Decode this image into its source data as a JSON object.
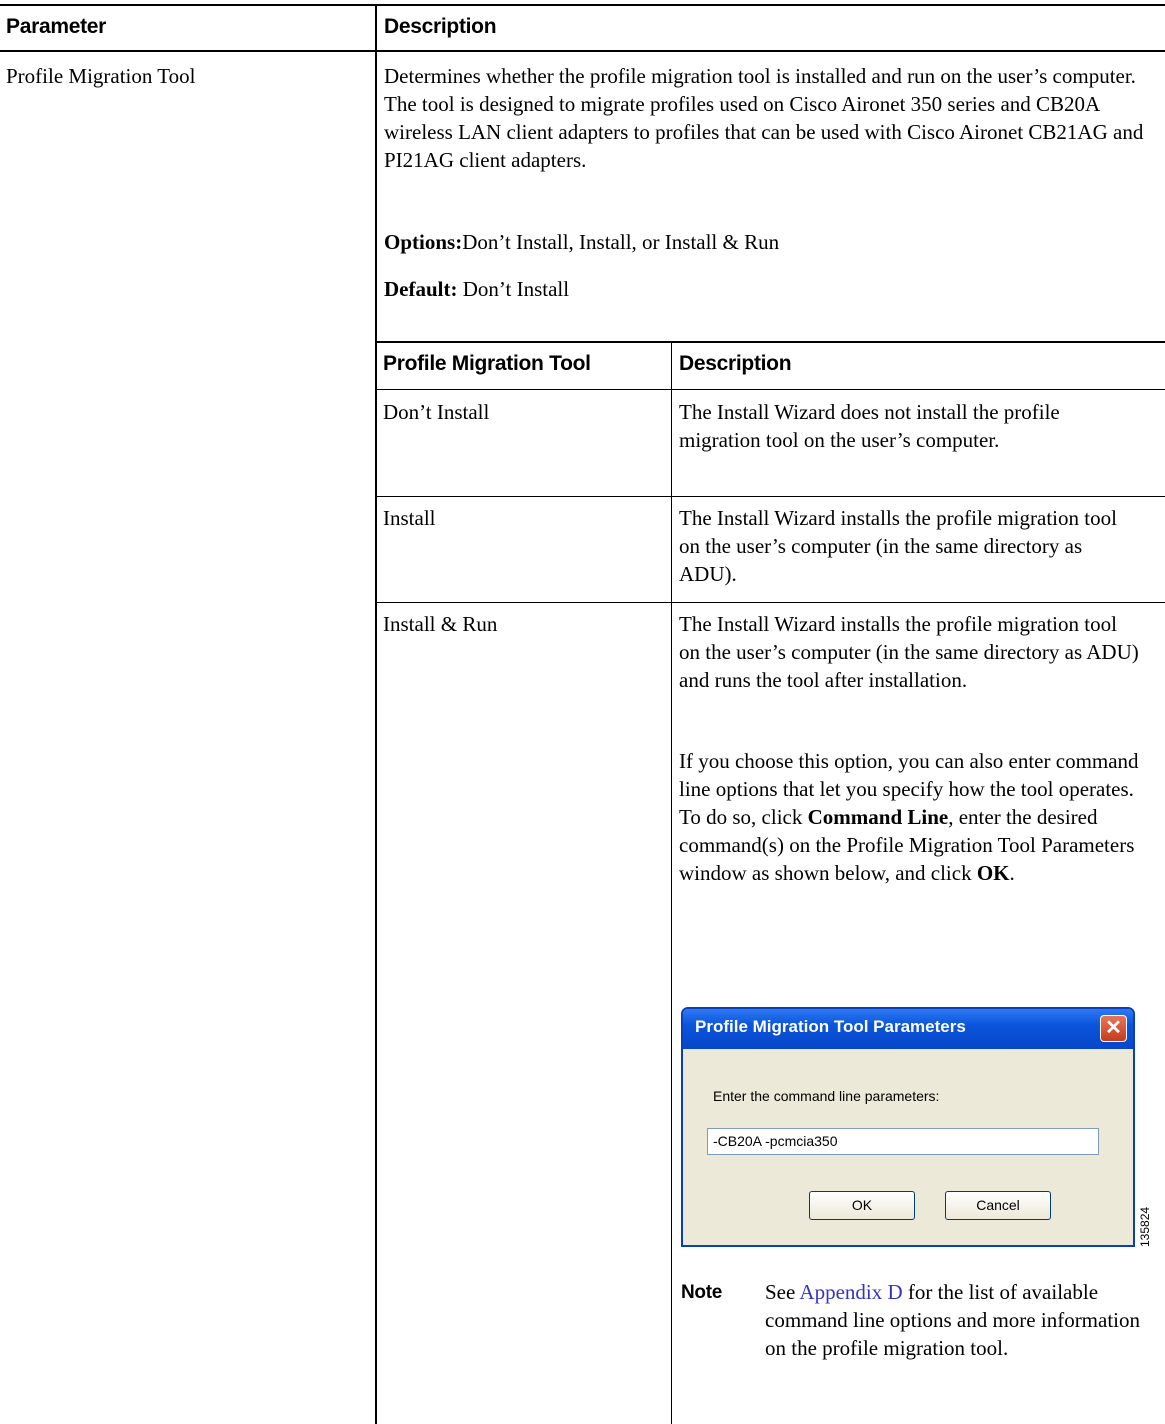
{
  "table": {
    "header": {
      "col1": "Parameter",
      "col2": "Description"
    },
    "row": {
      "parameter": "Profile Migration Tool",
      "description": "Determines whether the profile migration tool is installed and run on the user’s computer. The tool is designed to migrate profiles used on Cisco Aironet 350 series and CB20A wireless LAN client adapters to profiles that can be used with Cisco Aironet CB21AG and PI21AG client adapters.",
      "options_label": "Options:",
      "options_value": "Don’t Install, Install, or Install & Run",
      "default_label": "Default:",
      "default_value": " Don’t Install"
    }
  },
  "subtable": {
    "header": {
      "col1": "Profile Migration Tool",
      "col2": "Description"
    },
    "rows": [
      {
        "option": "Don’t Install",
        "description": "The Install Wizard does not install the profile migration tool on the user’s computer."
      },
      {
        "option": "Install",
        "description": "The Install Wizard installs the profile migration tool on the user’s computer (in the same directory as ADU)."
      },
      {
        "option": "Install & Run",
        "description": "The Install Wizard installs the profile migration tool on the user’s computer (in the same directory as ADU) and runs the tool after installation."
      }
    ],
    "install_run_more": {
      "p1": "If you choose this option, you can also enter command line options that let you specify how the tool operates. To do so, click ",
      "cmd": "Command Line",
      "p2": ", enter the desired command(s) on the Profile Migration Tool Parameters window as shown below, and click ",
      "ok": "OK",
      "p3": "."
    }
  },
  "dialog": {
    "title": "Profile Migration Tool Parameters",
    "label": "Enter the command line parameters:",
    "input_value": "-CB20A -pcmcia350",
    "ok_button": "OK",
    "cancel_button": "Cancel",
    "figure_id": "135824"
  },
  "note": {
    "label": "Note",
    "text1": "See ",
    "link": "Appendix D",
    "text2": " for the list of available command line options and more information on the profile migration tool."
  },
  "colors": {
    "link": "#3333cc",
    "title_bar": "#0a55dc",
    "dialog_bg": "#ece9d8"
  }
}
